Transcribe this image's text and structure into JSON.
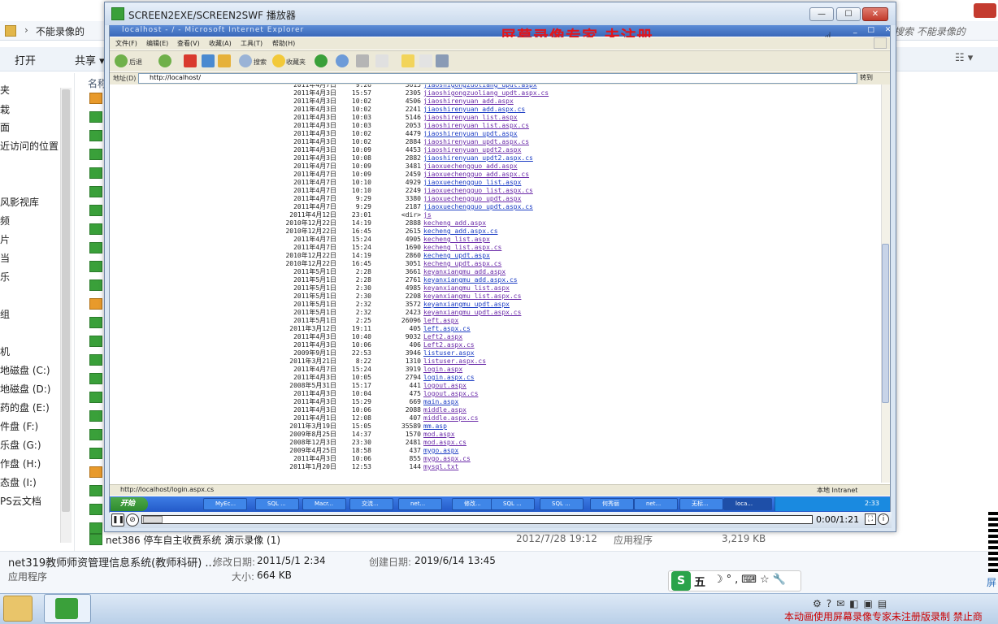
{
  "explorer": {
    "address_crumb": "不能录像的",
    "search_placeholder": "搜索 不能录像的",
    "toolbar": {
      "open": "打开",
      "share": "共享 ▾",
      "view": "☷ ▾"
    },
    "nav_items": [
      "夹",
      "栽",
      "面",
      "近访问的位置",
      "风影视库",
      "频",
      "片",
      "当",
      "乐",
      "组",
      "机",
      "地磁盘 (C:)",
      "地磁盘 (D:)",
      "药的盘 (E:)",
      "件盘 (F:)",
      "乐盘 (G:)",
      "作盘 (H:)",
      "态盘 (I:)",
      "PS云文档"
    ],
    "column_name": "名称",
    "last_row": {
      "name": "net386 停车自主收费系统 演示录像 (1)",
      "date": "2012/7/28 19:12",
      "type": "应用程序",
      "size": "3,219 KB"
    },
    "details": {
      "name": "net319教师师资管理信息系统(教师科研) ...",
      "type": "应用程序",
      "modified_label": "修改日期:",
      "modified": "2011/5/1 2:34",
      "created_label": "创建日期:",
      "created": "2019/6/14 13:45",
      "size_label": "大小:",
      "size": "664 KB"
    },
    "ime": {
      "logo": "S",
      "mode": "五",
      "rest": "☽°,⌨☆🔧"
    }
  },
  "taskbar": {
    "notice": "本动画使用屏幕录像专家未注册版录制 禁止商",
    "qr_text": "屏"
  },
  "player": {
    "title": "SCREEN2EXE/SCREEN2SWF 播放器",
    "min": "—",
    "max": "☐",
    "close": "✕",
    "watermark": "屏幕录像专家  未注册",
    "time": "0:00/1:21",
    "pause": "❚❚",
    "stop": "⊘",
    "fullscreen": "⛶",
    "info": "i"
  },
  "ie": {
    "title": "localhost - / - Microsoft Internet Explorer",
    "title_btns": "_ □ ✕",
    "menu": [
      "文件(F)",
      "编辑(E)",
      "查看(V)",
      "收藏(A)",
      "工具(T)",
      "帮助(H)"
    ],
    "toolbar": {
      "back": "后退",
      "search": "搜索",
      "favorites": "收藏夹"
    },
    "address_label": "地址(D)",
    "address": "http://localhost/",
    "go": "转到",
    "status": "http://localhost/login.aspx.cs",
    "zone": "本地 Intranet",
    "start": "开始",
    "taskbuttons": [
      "MyEc...",
      "SQL ...",
      "Macr...",
      "交流...",
      "net...",
      "修改...",
      "SQL ...",
      "SQL ...",
      "何秀丽",
      "net...",
      "无标...",
      "loca..."
    ],
    "clock": "2:33"
  },
  "listing": [
    {
      "d": "2011年4月7日",
      "t": "9:26",
      "s": "3615",
      "n": "jiaoshigongzuoliang_updt.aspx"
    },
    {
      "d": "2011年4月3日",
      "t": "15:57",
      "s": "2305",
      "n": "jiaoshigongzuoliang_updt.aspx.cs"
    },
    {
      "d": "2011年4月3日",
      "t": "10:02",
      "s": "4506",
      "n": "jiaoshirenyuan_add.aspx"
    },
    {
      "d": "2011年4月3日",
      "t": "10:02",
      "s": "2241",
      "n": "jiaoshirenyuan_add.aspx.cs"
    },
    {
      "d": "2011年4月3日",
      "t": "10:03",
      "s": "5146",
      "n": "jiaoshirenyuan_list.aspx"
    },
    {
      "d": "2011年4月3日",
      "t": "10:03",
      "s": "2053",
      "n": "jiaoshirenyuan_list.aspx.cs"
    },
    {
      "d": "2011年4月3日",
      "t": "10:02",
      "s": "4479",
      "n": "jiaoshirenyuan_updt.aspx"
    },
    {
      "d": "2011年4月3日",
      "t": "10:02",
      "s": "2884",
      "n": "jiaoshirenyuan_updt.aspx.cs"
    },
    {
      "d": "2011年4月3日",
      "t": "10:09",
      "s": "4453",
      "n": "jiaoshirenyuan_updt2.aspx"
    },
    {
      "d": "2011年4月3日",
      "t": "10:08",
      "s": "2882",
      "n": "jiaoshirenyuan_updt2.aspx.cs"
    },
    {
      "d": "2011年4月7日",
      "t": "10:09",
      "s": "3481",
      "n": "jiaoxuechengguo_add.aspx"
    },
    {
      "d": "2011年4月7日",
      "t": "10:09",
      "s": "2459",
      "n": "jiaoxuechengguo_add.aspx.cs"
    },
    {
      "d": "2011年4月7日",
      "t": "10:10",
      "s": "4929",
      "n": "jiaoxuechengguo_list.aspx"
    },
    {
      "d": "2011年4月7日",
      "t": "10:10",
      "s": "2249",
      "n": "jiaoxuechengguo_list.aspx.cs"
    },
    {
      "d": "2011年4月7日",
      "t": "9:29",
      "s": "3380",
      "n": "jiaoxuechengguo_updt.aspx"
    },
    {
      "d": "2011年4月7日",
      "t": "9:29",
      "s": "2187",
      "n": "jiaoxuechengguo_updt.aspx.cs"
    },
    {
      "d": "2011年4月12日",
      "t": "23:01",
      "s": "<dir>",
      "n": "js"
    },
    {
      "d": "2010年12月22日",
      "t": "14:19",
      "s": "2888",
      "n": "kecheng_add.aspx"
    },
    {
      "d": "2010年12月22日",
      "t": "16:45",
      "s": "2615",
      "n": "kecheng_add.aspx.cs"
    },
    {
      "d": "2011年4月7日",
      "t": "15:24",
      "s": "4905",
      "n": "kecheng_list.aspx"
    },
    {
      "d": "2011年4月7日",
      "t": "15:24",
      "s": "1690",
      "n": "kecheng_list.aspx.cs"
    },
    {
      "d": "2010年12月22日",
      "t": "14:19",
      "s": "2860",
      "n": "kecheng_updt.aspx"
    },
    {
      "d": "2010年12月22日",
      "t": "16:45",
      "s": "3051",
      "n": "kecheng_updt.aspx.cs"
    },
    {
      "d": "2011年5月1日",
      "t": "2:28",
      "s": "3661",
      "n": "keyanxiangmu_add.aspx"
    },
    {
      "d": "2011年5月1日",
      "t": "2:28",
      "s": "2761",
      "n": "keyanxiangmu_add.aspx.cs"
    },
    {
      "d": "2011年5月1日",
      "t": "2:30",
      "s": "4985",
      "n": "keyanxiangmu_list.aspx"
    },
    {
      "d": "2011年5月1日",
      "t": "2:30",
      "s": "2208",
      "n": "keyanxiangmu_list.aspx.cs"
    },
    {
      "d": "2011年5月1日",
      "t": "2:32",
      "s": "3572",
      "n": "keyanxiangmu_updt.aspx"
    },
    {
      "d": "2011年5月1日",
      "t": "2:32",
      "s": "2423",
      "n": "keyanxiangmu_updt.aspx.cs"
    },
    {
      "d": "2011年5月1日",
      "t": "2:25",
      "s": "26096",
      "n": "left.aspx"
    },
    {
      "d": "2011年3月12日",
      "t": "19:11",
      "s": "405",
      "n": "left.aspx.cs"
    },
    {
      "d": "2011年4月3日",
      "t": "10:40",
      "s": "9032",
      "n": "Left2.aspx"
    },
    {
      "d": "2011年4月3日",
      "t": "10:06",
      "s": "406",
      "n": "Left2.aspx.cs"
    },
    {
      "d": "2009年9月1日",
      "t": "22:53",
      "s": "3946",
      "n": "listuser.aspx"
    },
    {
      "d": "2011年3月21日",
      "t": "8:22",
      "s": "1310",
      "n": "listuser.aspx.cs"
    },
    {
      "d": "2011年4月7日",
      "t": "15:24",
      "s": "3919",
      "n": "login.aspx"
    },
    {
      "d": "2011年4月3日",
      "t": "10:05",
      "s": "2794",
      "n": "login.aspx.cs"
    },
    {
      "d": "2008年5月31日",
      "t": "15:17",
      "s": "441",
      "n": "logout.aspx"
    },
    {
      "d": "2011年4月3日",
      "t": "10:04",
      "s": "475",
      "n": "logout.aspx.cs"
    },
    {
      "d": "2011年4月3日",
      "t": "15:29",
      "s": "669",
      "n": "main.aspx"
    },
    {
      "d": "2011年4月3日",
      "t": "10:06",
      "s": "2088",
      "n": "middle.aspx"
    },
    {
      "d": "2011年4月1日",
      "t": "12:08",
      "s": "407",
      "n": "middle.aspx.cs"
    },
    {
      "d": "2011年3月19日",
      "t": "15:05",
      "s": "35589",
      "n": "mm.asp"
    },
    {
      "d": "2009年8月25日",
      "t": "14:37",
      "s": "1570",
      "n": "mod.aspx"
    },
    {
      "d": "2008年12月3日",
      "t": "23:30",
      "s": "2481",
      "n": "mod.aspx.cs"
    },
    {
      "d": "2009年4月25日",
      "t": "18:58",
      "s": "437",
      "n": "mygo.aspx"
    },
    {
      "d": "2011年4月3日",
      "t": "10:06",
      "s": "855",
      "n": "mygo.aspx.cs"
    },
    {
      "d": "2011年1月20日",
      "t": "12:53",
      "s": "144",
      "n": "mysql.txt"
    }
  ]
}
